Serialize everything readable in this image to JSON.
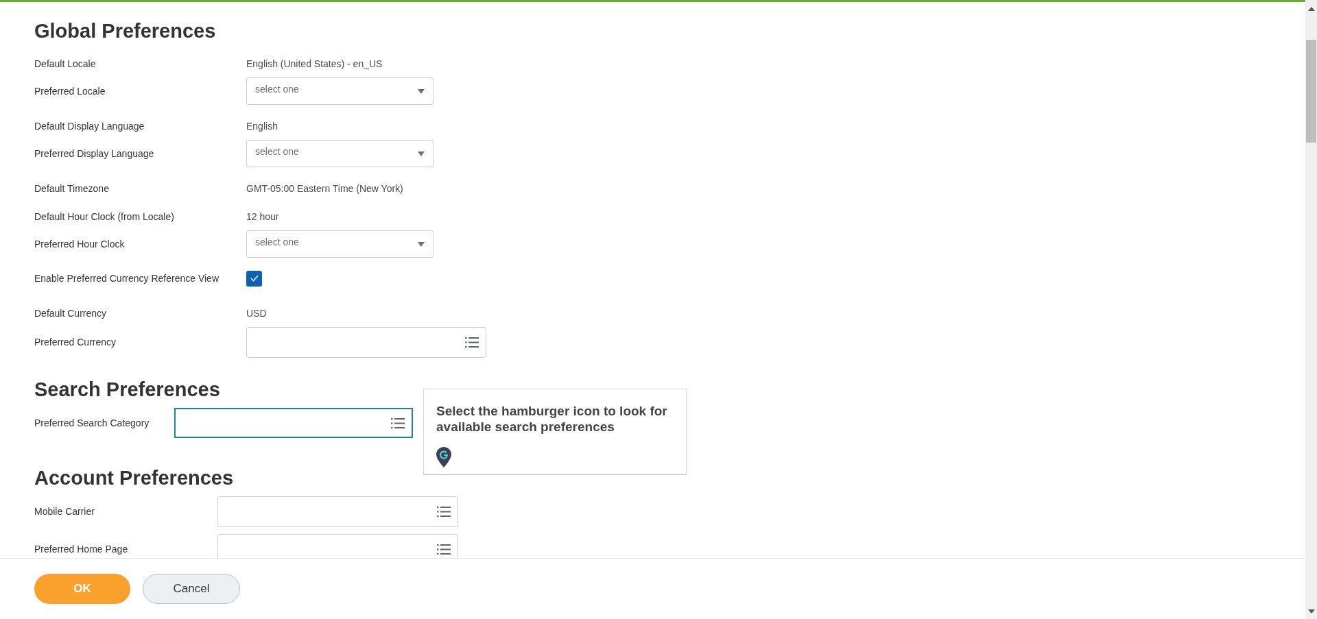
{
  "sections": [
    {
      "title": "Global Preferences",
      "rows": [
        {
          "kind": "text",
          "label": "Default Locale",
          "value": "English (United States) - en_US"
        },
        {
          "kind": "select",
          "label": "Preferred Locale",
          "placeholder": "select one"
        },
        {
          "kind": "text",
          "label": "Default Display Language",
          "value": "English"
        },
        {
          "kind": "select",
          "label": "Preferred Display Language",
          "placeholder": "select one"
        },
        {
          "kind": "text",
          "label": "Default Timezone",
          "value": "GMT-05:00 Eastern Time (New York)"
        },
        {
          "kind": "text",
          "label": "Default Hour Clock (from Locale)",
          "value": "12 hour"
        },
        {
          "kind": "select",
          "label": "Preferred Hour Clock",
          "placeholder": "select one"
        },
        {
          "kind": "checkbox",
          "label": "Enable Preferred Currency Reference View",
          "checked": true
        },
        {
          "kind": "text",
          "label": "Default Currency",
          "value": "USD"
        },
        {
          "kind": "prompt",
          "label": "Preferred Currency",
          "focused": false
        }
      ]
    },
    {
      "title": "Search Preferences",
      "rows": [
        {
          "kind": "prompt",
          "label": "Preferred Search Category",
          "focused": true
        }
      ]
    },
    {
      "title": "Account Preferences",
      "rows": [
        {
          "kind": "prompt",
          "label": "Mobile Carrier",
          "focused": false
        },
        {
          "kind": "prompt",
          "label": "Preferred Home Page",
          "focused": false
        }
      ]
    }
  ],
  "tooltip": {
    "text": "Select the hamburger icon to look for available search preferences"
  },
  "buttons": [
    {
      "label": "OK",
      "kind": "primary"
    },
    {
      "label": "Cancel",
      "kind": "secondary"
    }
  ]
}
